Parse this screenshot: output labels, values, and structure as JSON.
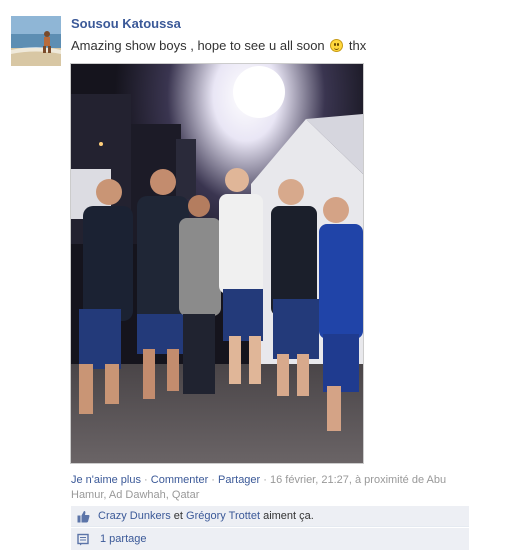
{
  "post": {
    "author": "Sousou Katoussa",
    "message_before": "Amazing show boys , hope to see u all soon",
    "message_after": "thx"
  },
  "actions": {
    "unlike": "Je n'aime plus",
    "sep1": " · ",
    "comment": "Commenter",
    "sep2": " · ",
    "share": "Partager",
    "meta": " · 16 février, 21:27, à proximité de Abu Hamur, Ad Dawhah, Qatar"
  },
  "likes": {
    "user1": "Crazy Dunkers",
    "conj": " et ",
    "user2": "Grégory Trottet",
    "suffix": " aiment ça."
  },
  "shares": {
    "label": "1 partage"
  },
  "icons": {
    "like": "thumbs-up-icon",
    "share": "share-icon",
    "emoticon": "smiley-icon"
  },
  "colors": {
    "link": "#3b5998",
    "meta": "#999999",
    "box_bg": "#edeff4"
  }
}
